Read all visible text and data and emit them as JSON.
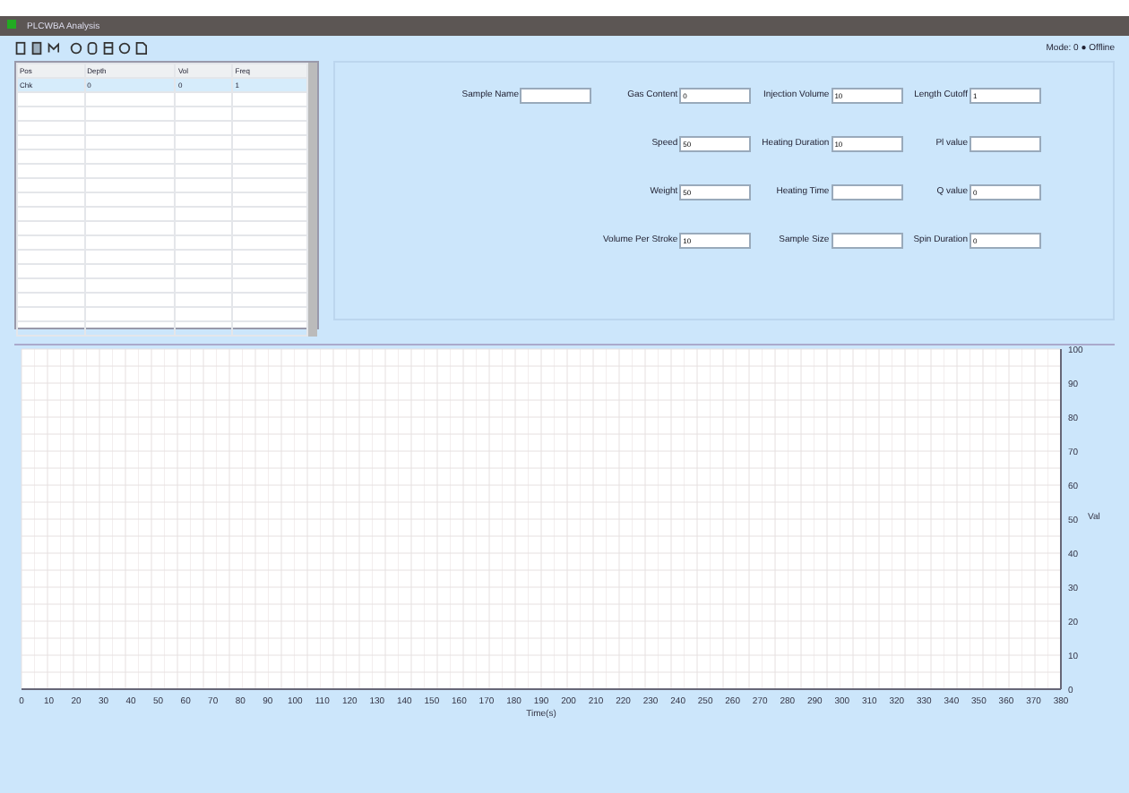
{
  "window": {
    "title": "PLCWBA Analysis"
  },
  "status": "Mode: 0 ● Offline",
  "table": {
    "columns": [
      "Pos",
      "Depth",
      "Vol",
      "Freq"
    ],
    "rows": [
      {
        "cells": [
          "Chk",
          "0",
          "0",
          "1"
        ],
        "selected": true
      }
    ]
  },
  "form": [
    {
      "label": "Sample Name"
    },
    {
      "label": "Gas Content",
      "value": "0"
    },
    {
      "label": "Injection Volume",
      "value": "10"
    },
    {
      "label": "Length Cutoff",
      "value": "1"
    },
    {
      "label": "Speed",
      "value": "50"
    },
    {
      "label": "Heating Duration",
      "value": "10"
    },
    {
      "label": "Pl value"
    },
    {
      "label": "Weight",
      "value": "50"
    },
    {
      "label": "Heating Time"
    },
    {
      "label": "Q value",
      "value": "0"
    },
    {
      "label": "Volume Per Stroke",
      "value": "10"
    },
    {
      "label": "Sample Size"
    },
    {
      "label": "Spin Duration",
      "value": "0"
    }
  ],
  "chart": {
    "chart_data": {
      "type": "line",
      "xlabel": "Time(s)",
      "ylabel": "Val",
      "grid": true,
      "xlim": [
        0,
        380
      ],
      "ylim": [
        0,
        100
      ],
      "xticks": [
        0,
        10,
        20,
        30,
        40,
        50,
        60,
        70,
        80,
        90,
        100,
        110,
        120,
        130,
        140,
        150,
        160,
        170,
        180,
        190,
        200,
        210,
        220,
        230,
        240,
        250,
        260,
        270,
        280,
        290,
        300,
        310,
        320,
        330,
        340,
        350,
        360,
        370,
        380
      ],
      "yticks": [
        0,
        10,
        20,
        30,
        40,
        50,
        60,
        70,
        80,
        90,
        100
      ]
    }
  }
}
